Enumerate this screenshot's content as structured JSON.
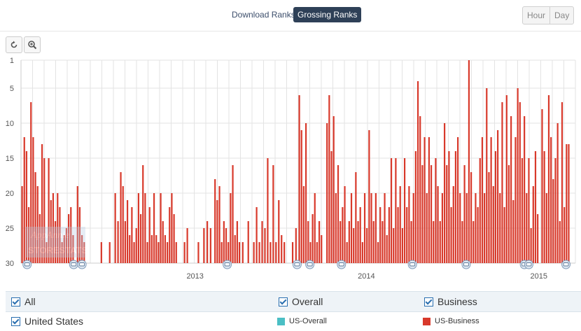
{
  "tabs": {
    "download": "Download Ranks",
    "grossing": "Grossing Ranks",
    "active": "grossing"
  },
  "granularity": {
    "hour": "Hour",
    "day": "Day"
  },
  "toolbar": {
    "reset_icon": "reset-icon",
    "zoom_icon": "zoom-in-icon"
  },
  "filters": {
    "all": "All",
    "overall": "Overall",
    "business": "Business",
    "country": "United States",
    "series_overall": "US-Overall",
    "series_business": "US-Business",
    "color_overall": "#4bbfc5",
    "color_business": "#d8392b"
  },
  "chart_data": {
    "type": "bar",
    "xlabel": "",
    "ylabel": "",
    "x_ticks": [
      "2013",
      "2014",
      "2015"
    ],
    "y_ticks": [
      1,
      5,
      10,
      15,
      20,
      25,
      30
    ],
    "ylim": [
      1,
      30
    ],
    "y_reversed": true,
    "grid": true,
    "series": [
      {
        "name": "US-Business",
        "color": "#d8392b",
        "spikes": [
          [
            0.2,
            19
          ],
          [
            0.6,
            12
          ],
          [
            1.0,
            14
          ],
          [
            1.4,
            22
          ],
          [
            1.8,
            7
          ],
          [
            2.2,
            12
          ],
          [
            2.6,
            17
          ],
          [
            3.0,
            19
          ],
          [
            3.4,
            23
          ],
          [
            3.8,
            13
          ],
          [
            4.2,
            15
          ],
          [
            4.6,
            27
          ],
          [
            5.0,
            15
          ],
          [
            5.4,
            21
          ],
          [
            5.8,
            20
          ],
          [
            6.2,
            24
          ],
          [
            6.6,
            20
          ],
          [
            7.0,
            22
          ],
          [
            7.4,
            27
          ],
          [
            7.8,
            26
          ],
          [
            8.2,
            25
          ],
          [
            8.6,
            23
          ],
          [
            9.0,
            22
          ],
          [
            9.4,
            26
          ],
          [
            10.2,
            19
          ],
          [
            10.6,
            22
          ],
          [
            11.0,
            26
          ],
          [
            11.4,
            27
          ],
          [
            14.5,
            27
          ],
          [
            16.0,
            27
          ],
          [
            17.0,
            20
          ],
          [
            17.5,
            24
          ],
          [
            18.0,
            17
          ],
          [
            18.4,
            19
          ],
          [
            18.8,
            24
          ],
          [
            19.2,
            21
          ],
          [
            19.6,
            26
          ],
          [
            20.0,
            22
          ],
          [
            20.4,
            27
          ],
          [
            20.8,
            25
          ],
          [
            21.2,
            20
          ],
          [
            21.6,
            23
          ],
          [
            22.0,
            16
          ],
          [
            22.4,
            20
          ],
          [
            22.8,
            27
          ],
          [
            23.2,
            22
          ],
          [
            23.6,
            26
          ],
          [
            24.0,
            20
          ],
          [
            24.4,
            26
          ],
          [
            24.8,
            27
          ],
          [
            25.2,
            20
          ],
          [
            25.6,
            24
          ],
          [
            26.0,
            26
          ],
          [
            26.4,
            27
          ],
          [
            26.8,
            22
          ],
          [
            27.2,
            20
          ],
          [
            27.6,
            23
          ],
          [
            28.0,
            27
          ],
          [
            29.5,
            27
          ],
          [
            30.0,
            25
          ],
          [
            32.0,
            27
          ],
          [
            33.0,
            25
          ],
          [
            33.6,
            24
          ],
          [
            34.2,
            25
          ],
          [
            35.0,
            18
          ],
          [
            35.4,
            21
          ],
          [
            35.8,
            19
          ],
          [
            36.2,
            27
          ],
          [
            36.6,
            24
          ],
          [
            37.0,
            25
          ],
          [
            37.4,
            27
          ],
          [
            37.8,
            20
          ],
          [
            38.2,
            16
          ],
          [
            38.6,
            26
          ],
          [
            39.0,
            24
          ],
          [
            39.4,
            27
          ],
          [
            40.0,
            27
          ],
          [
            41.0,
            24
          ],
          [
            42.0,
            27
          ],
          [
            42.5,
            22
          ],
          [
            43.0,
            27
          ],
          [
            43.5,
            24
          ],
          [
            44.0,
            25
          ],
          [
            44.5,
            15
          ],
          [
            45.0,
            27
          ],
          [
            45.5,
            16
          ],
          [
            46.0,
            27
          ],
          [
            46.5,
            21
          ],
          [
            47.0,
            26
          ],
          [
            47.5,
            27
          ],
          [
            49.0,
            27
          ],
          [
            49.6,
            25
          ],
          [
            50.2,
            6
          ],
          [
            50.6,
            11
          ],
          [
            51.0,
            19
          ],
          [
            51.4,
            10
          ],
          [
            51.8,
            24
          ],
          [
            52.2,
            27
          ],
          [
            52.6,
            23
          ],
          [
            53.0,
            20
          ],
          [
            53.4,
            27
          ],
          [
            53.8,
            24
          ],
          [
            54.2,
            26
          ],
          [
            55.2,
            10
          ],
          [
            55.6,
            6
          ],
          [
            56.0,
            14
          ],
          [
            56.4,
            9
          ],
          [
            56.8,
            20
          ],
          [
            57.2,
            16
          ],
          [
            57.6,
            24
          ],
          [
            58.0,
            22
          ],
          [
            58.4,
            19
          ],
          [
            58.8,
            27
          ],
          [
            59.2,
            24
          ],
          [
            59.6,
            20
          ],
          [
            60.0,
            25
          ],
          [
            60.4,
            17
          ],
          [
            60.8,
            24
          ],
          [
            61.2,
            22
          ],
          [
            61.6,
            27
          ],
          [
            62.0,
            20
          ],
          [
            62.4,
            25
          ],
          [
            62.8,
            11
          ],
          [
            63.2,
            20
          ],
          [
            63.6,
            24
          ],
          [
            64.0,
            20
          ],
          [
            64.4,
            27
          ],
          [
            64.8,
            22
          ],
          [
            65.2,
            24
          ],
          [
            65.6,
            20
          ],
          [
            66.0,
            26
          ],
          [
            66.4,
            22
          ],
          [
            66.8,
            15
          ],
          [
            67.2,
            25
          ],
          [
            67.6,
            15
          ],
          [
            68.0,
            22
          ],
          [
            68.4,
            19
          ],
          [
            68.8,
            25
          ],
          [
            69.2,
            15
          ],
          [
            69.6,
            22
          ],
          [
            70.0,
            19
          ],
          [
            70.4,
            24
          ],
          [
            70.8,
            20
          ],
          [
            71.2,
            14
          ],
          [
            71.6,
            4
          ],
          [
            72.0,
            9
          ],
          [
            72.4,
            16
          ],
          [
            72.8,
            12
          ],
          [
            73.2,
            20
          ],
          [
            73.6,
            12
          ],
          [
            74.0,
            16
          ],
          [
            74.4,
            24
          ],
          [
            74.8,
            15
          ],
          [
            75.2,
            19
          ],
          [
            75.6,
            24
          ],
          [
            76.0,
            20
          ],
          [
            76.4,
            10
          ],
          [
            76.8,
            16
          ],
          [
            77.2,
            14
          ],
          [
            77.6,
            22
          ],
          [
            78.0,
            19
          ],
          [
            78.4,
            14
          ],
          [
            78.8,
            12
          ],
          [
            79.2,
            20
          ],
          [
            79.6,
            24
          ],
          [
            80.0,
            16
          ],
          [
            80.4,
            20
          ],
          [
            80.8,
            1
          ],
          [
            81.2,
            17
          ],
          [
            81.6,
            24
          ],
          [
            82.0,
            20
          ],
          [
            82.4,
            22
          ],
          [
            82.8,
            15
          ],
          [
            83.2,
            12
          ],
          [
            83.6,
            20
          ],
          [
            84.0,
            5
          ],
          [
            84.4,
            17
          ],
          [
            84.8,
            12
          ],
          [
            85.2,
            19
          ],
          [
            85.6,
            14
          ],
          [
            86.0,
            11
          ],
          [
            86.4,
            20
          ],
          [
            86.8,
            7
          ],
          [
            87.2,
            22
          ],
          [
            87.6,
            6
          ],
          [
            88.0,
            16
          ],
          [
            88.4,
            9
          ],
          [
            88.8,
            21
          ],
          [
            89.2,
            12
          ],
          [
            89.6,
            5
          ],
          [
            90.0,
            7
          ],
          [
            90.4,
            15
          ],
          [
            90.8,
            9
          ],
          [
            91.2,
            20
          ],
          [
            91.6,
            15
          ],
          [
            92.0,
            25
          ],
          [
            92.4,
            19
          ],
          [
            92.8,
            14
          ],
          [
            93.2,
            23
          ],
          [
            94.0,
            8
          ],
          [
            94.4,
            14
          ],
          [
            94.8,
            20
          ],
          [
            95.2,
            6
          ],
          [
            95.6,
            12
          ],
          [
            96.0,
            18
          ],
          [
            96.4,
            15
          ],
          [
            96.8,
            10
          ],
          [
            97.2,
            24
          ],
          [
            97.6,
            7
          ],
          [
            98.0,
            22
          ],
          [
            98.4,
            13
          ],
          [
            98.8,
            13
          ]
        ]
      }
    ],
    "x_year_positions": {
      "2013": 31.4,
      "2014": 62.3,
      "2015": 93.4
    }
  },
  "watermark": {
    "line1": "AppAnnie",
    "line2": "STORESTATS"
  }
}
